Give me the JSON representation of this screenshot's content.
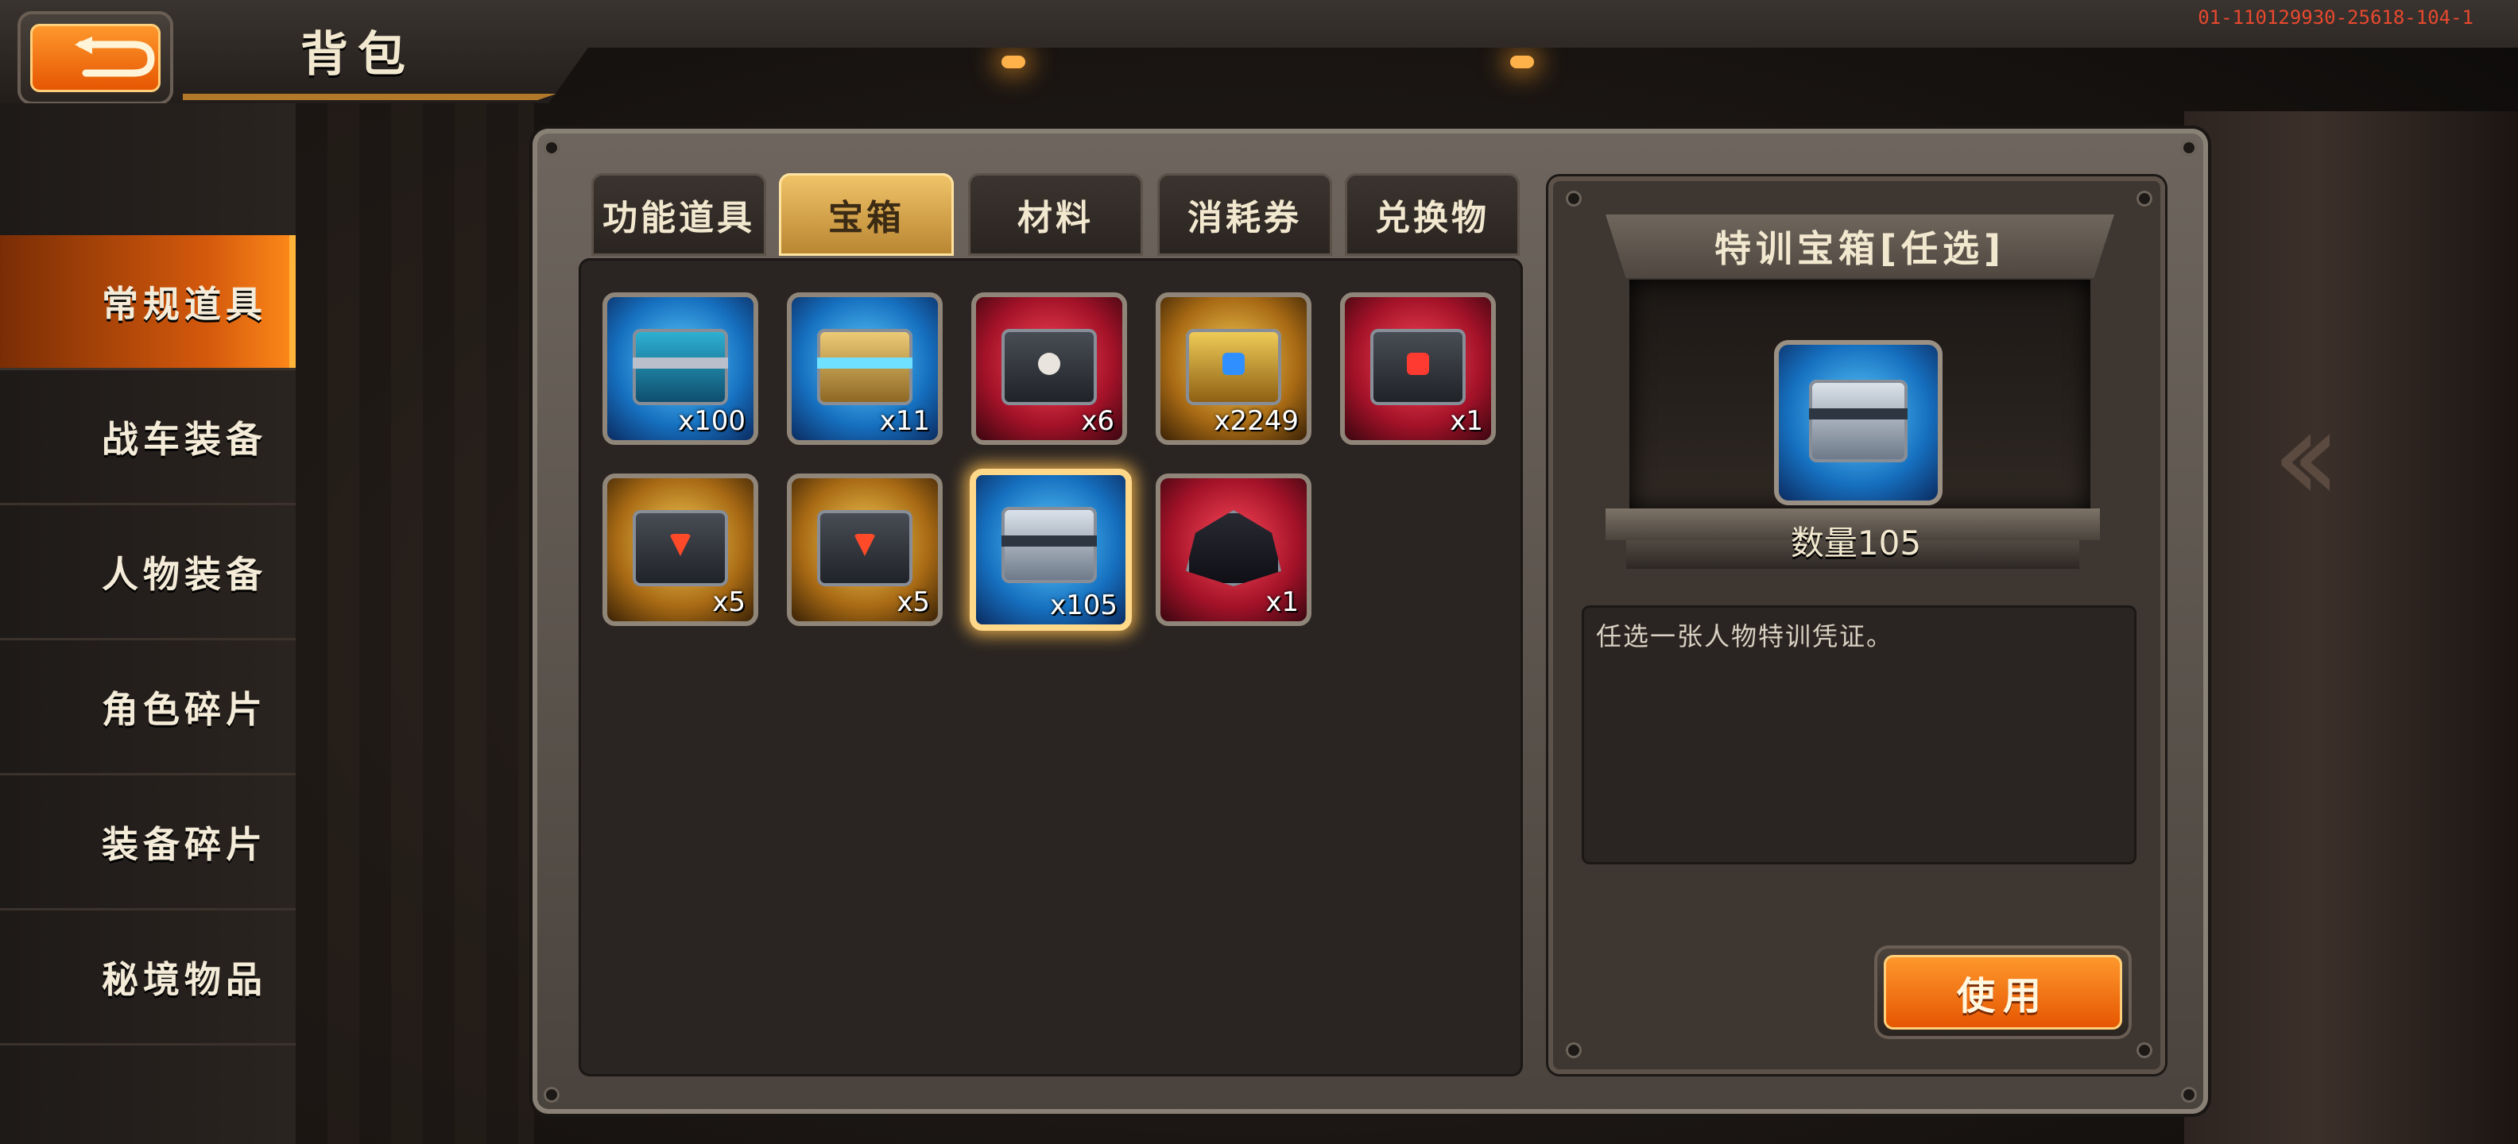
{
  "header": {
    "title": "背包",
    "version": "01-110129930-25618-104-1"
  },
  "sidebar": {
    "items": [
      {
        "label": "常规道具",
        "active": true
      },
      {
        "label": "战车装备",
        "active": false
      },
      {
        "label": "人物装备",
        "active": false
      },
      {
        "label": "角色碎片",
        "active": false
      },
      {
        "label": "装备碎片",
        "active": false
      },
      {
        "label": "秘境物品",
        "active": false
      }
    ]
  },
  "tabs": [
    {
      "label": "功能道具",
      "active": false
    },
    {
      "label": "宝箱",
      "active": true
    },
    {
      "label": "材料",
      "active": false
    },
    {
      "label": "消耗券",
      "active": false
    },
    {
      "label": "兑换物",
      "active": false
    }
  ],
  "items": [
    {
      "icon": "blue-chest-icon",
      "qty": "x100",
      "rarity": "blue"
    },
    {
      "icon": "gold-crate-icon",
      "qty": "x11",
      "rarity": "blue"
    },
    {
      "icon": "skull-box-icon",
      "qty": "x6",
      "rarity": "red"
    },
    {
      "icon": "blue-orb-chest-icon",
      "qty": "x2249",
      "rarity": "gold"
    },
    {
      "icon": "red-gem-box-icon",
      "qty": "x1",
      "rarity": "red"
    },
    {
      "icon": "gold-box-icon",
      "qty": "x5",
      "rarity": "gold"
    },
    {
      "icon": "gold-box-icon",
      "qty": "x5",
      "rarity": "gold"
    },
    {
      "icon": "training-chest-icon",
      "qty": "x105",
      "rarity": "blue",
      "selected": true
    },
    {
      "icon": "dark-armor-icon",
      "qty": "x1",
      "rarity": "red"
    }
  ],
  "detail": {
    "title": "特训宝箱[任选]",
    "count": "数量105",
    "description": "任选一张人物特训凭证。",
    "use_label": "使用"
  },
  "colors": {
    "accent": "#ff8a1a",
    "gold": "#f1c56a",
    "rarity_blue": "#1670c0",
    "rarity_gold": "#a86a14",
    "rarity_red": "#a31228"
  }
}
